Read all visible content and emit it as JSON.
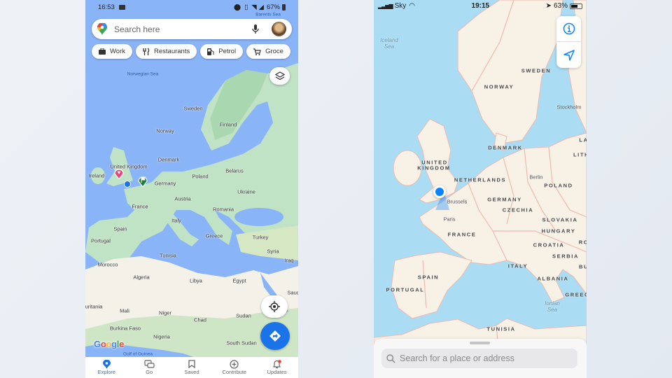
{
  "google_maps": {
    "status": {
      "time": "16:53",
      "battery": "67%"
    },
    "search": {
      "placeholder": "Search here"
    },
    "chips": [
      {
        "label": "Work",
        "icon": "briefcase-icon"
      },
      {
        "label": "Restaurants",
        "icon": "fork-knife-icon"
      },
      {
        "label": "Petrol",
        "icon": "fuel-pump-icon"
      },
      {
        "label": "Groce",
        "icon": "cart-icon"
      }
    ],
    "map_labels": [
      "Barents Sea",
      "Norwegian Sea",
      "Sweden",
      "Finland",
      "Norway",
      "Denmark",
      "United Kingdom",
      "Ireland",
      "Belarus",
      "Poland",
      "Germany",
      "Ukraine",
      "Austria",
      "France",
      "Romania",
      "Italy",
      "Spain",
      "Portugal",
      "Greece",
      "Turkey",
      "Tunisia",
      "Syria",
      "Iraq",
      "Morocco",
      "Algeria",
      "Libya",
      "Egypt",
      "Saudi",
      "uritania",
      "Mali",
      "Niger",
      "Chad",
      "Sudan",
      "Burkina Faso",
      "Nigeria",
      "South Sudan",
      "Gulf of Guinea"
    ],
    "logo": "Google",
    "nav": [
      {
        "label": "Explore",
        "active": true
      },
      {
        "label": "Go"
      },
      {
        "label": "Saved"
      },
      {
        "label": "Contribute"
      },
      {
        "label": "Updates",
        "badge": true
      }
    ],
    "colors": {
      "accent": "#1a73e8",
      "sea": "#8ab4f8",
      "land": "#bfe3c4",
      "desert": "#f4f1e8"
    }
  },
  "apple_maps": {
    "status": {
      "carrier": "Sky",
      "time": "19:15",
      "battery": "63%"
    },
    "map_labels": [
      "Iceland\nSea",
      "SWEDEN",
      "NORWAY",
      "Stockholm",
      "DENMARK",
      "LA",
      "LITHU",
      "UNITED",
      "KINGDOM",
      "NETHERLANDS",
      "Berlin",
      "POLAND",
      "Brussels",
      "GERMANY",
      "Paris",
      "CZECHIA",
      "SLOVAKIA",
      "FRANCE",
      "HUNGARY",
      "CROATIA",
      "RO",
      "SERBIA",
      "BU",
      "ITALY",
      "ALBANIA",
      "SPAIN",
      "PORTUGAL",
      "GREECE",
      "Ionian\nSea",
      "TUNISIA"
    ],
    "search": {
      "placeholder": "Search for a place or address"
    },
    "colors": {
      "accent": "#0a84ff",
      "sea": "#aadcf3",
      "land": "#f7f1e6",
      "border": "#f0b8b0"
    }
  }
}
